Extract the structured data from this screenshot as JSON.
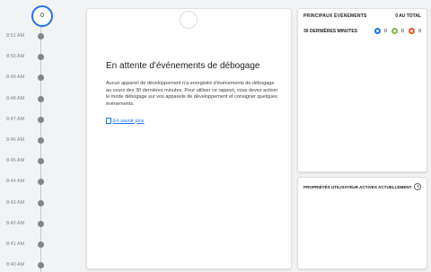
{
  "timeline": {
    "counter": "0",
    "times": [
      "8:51 AM",
      "8:50 AM",
      "8:49 AM",
      "8:48 AM",
      "8:47 AM",
      "8:46 AM",
      "8:45 AM",
      "8:44 AM",
      "8:43 AM",
      "8:42 AM",
      "8:41 AM",
      "8:40 AM"
    ]
  },
  "main": {
    "title": "En attente d'événements de débogage",
    "description": "Aucun appareil de développement n'a enregistré d'événements de débogage au cours des 30 dernières minutes. Pour utiliser ce rapport, vous devez activer le mode débogage sur vos appareils de développement et consigner quelques événements.",
    "learn_more": "En savoir plus"
  },
  "top_events": {
    "title": "PRINCIPAUX ÉVÉNEMENTS",
    "total": "0 AU TOTAL",
    "row_label": "30 DERNIÈRES MINUTES",
    "badges": [
      {
        "icon": "info-badge-icon",
        "color": "#1a73e8",
        "count": "0"
      },
      {
        "icon": "conversion-badge-icon",
        "color": "#7cb342",
        "count": "0"
      },
      {
        "icon": "error-badge-icon",
        "color": "#f4511e",
        "count": "0"
      }
    ]
  },
  "user_props": {
    "title": "PROPRIÉTÉS UTILISATEUR ACTIVES ACTUELLEMENT",
    "icon": "history-icon"
  }
}
